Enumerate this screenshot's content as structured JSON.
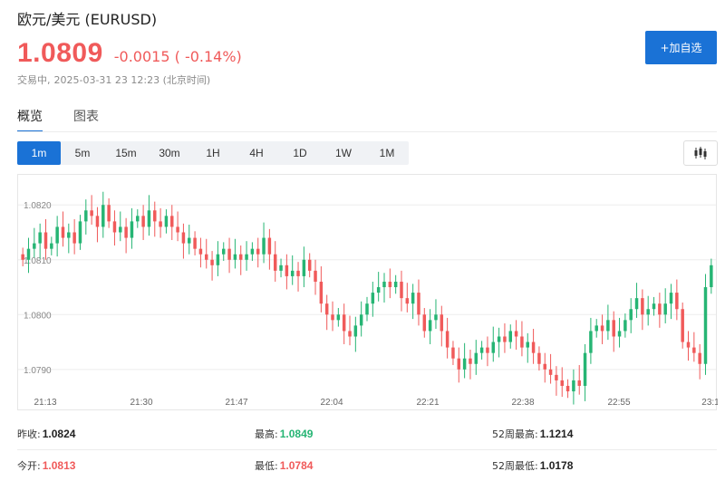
{
  "header": {
    "title": "欧元/美元  (EURUSD)",
    "price": "1.0809",
    "change": "-0.0015 ( -0.14%)",
    "status": "交易中,",
    "timestamp": "2025-03-31 23 12:23  (北京时间)",
    "add_button": "+加自选"
  },
  "tabs": [
    {
      "label": "概览",
      "active": true
    },
    {
      "label": "图表",
      "active": false
    }
  ],
  "intervals": [
    "1m",
    "5m",
    "15m",
    "30m",
    "1H",
    "4H",
    "1D",
    "1W",
    "1M"
  ],
  "active_interval": "1m",
  "chart_type_icon": "candlestick-icon",
  "colors": {
    "up": "#26b574",
    "down": "#f05a5a",
    "accent": "#1a72d6",
    "grid": "#eeeeee"
  },
  "chart_data": {
    "type": "candlestick",
    "x_ticks": [
      "21:13",
      "21:30",
      "21:47",
      "22:04",
      "22:21",
      "22:38",
      "22:55",
      "23:1"
    ],
    "y_ticks": [
      "1.0820",
      "1.0810",
      "1.0800",
      "1.0790"
    ],
    "ylim": [
      1.07865,
      1.08245
    ],
    "grid": true,
    "close_series": [
      1.081,
      1.0812,
      1.0813,
      1.0815,
      1.0812,
      1.0813,
      1.0816,
      1.0814,
      1.0815,
      1.0813,
      1.0817,
      1.0819,
      1.0818,
      1.0816,
      1.082,
      1.0817,
      1.0815,
      1.0816,
      1.0814,
      1.0817,
      1.0818,
      1.0816,
      1.0819,
      1.0817,
      1.0816,
      1.0818,
      1.0816,
      1.0815,
      1.0813,
      1.0814,
      1.0812,
      1.0811,
      1.081,
      1.0809,
      1.0811,
      1.0812,
      1.081,
      1.0811,
      1.081,
      1.0811,
      1.0812,
      1.0811,
      1.0814,
      1.0811,
      1.0808,
      1.0809,
      1.0807,
      1.0808,
      1.0807,
      1.081,
      1.0808,
      1.0806,
      1.0802,
      1.08,
      1.0799,
      1.08,
      1.0797,
      1.0796,
      1.0798,
      1.08,
      1.0802,
      1.0804,
      1.0805,
      1.0806,
      1.0805,
      1.0806,
      1.0803,
      1.0802,
      1.0804,
      1.08,
      1.0797,
      1.0799,
      1.08,
      1.0797,
      1.0794,
      1.0792,
      1.079,
      1.0792,
      1.0791,
      1.0793,
      1.0794,
      1.0793,
      1.0795,
      1.0796,
      1.0795,
      1.0797,
      1.0796,
      1.0794,
      1.0795,
      1.0793,
      1.0791,
      1.079,
      1.0789,
      1.0788,
      1.0787,
      1.0786,
      1.0788,
      1.0787,
      1.0793,
      1.0797,
      1.0798,
      1.0797,
      1.0799,
      1.0796,
      1.0797,
      1.0799,
      1.0801,
      1.0803,
      1.08,
      1.0801,
      1.0802,
      1.08,
      1.0802,
      1.0804,
      1.0801,
      1.0795,
      1.0794,
      1.0793,
      1.0791,
      1.0805,
      1.0809
    ],
    "high": 1.0849,
    "low": 1.0784
  },
  "stats": [
    [
      {
        "label": "昨收:",
        "value": "1.0824",
        "tone": "neutral"
      },
      {
        "label": "最高:",
        "value": "1.0849",
        "tone": "up"
      },
      {
        "label": "52周最高:",
        "value": "1.1214",
        "tone": "neutral"
      }
    ],
    [
      {
        "label": "今开:",
        "value": "1.0813",
        "tone": "down"
      },
      {
        "label": "最低:",
        "value": "1.0784",
        "tone": "down"
      },
      {
        "label": "52周最低:",
        "value": "1.0178",
        "tone": "neutral"
      }
    ]
  ]
}
